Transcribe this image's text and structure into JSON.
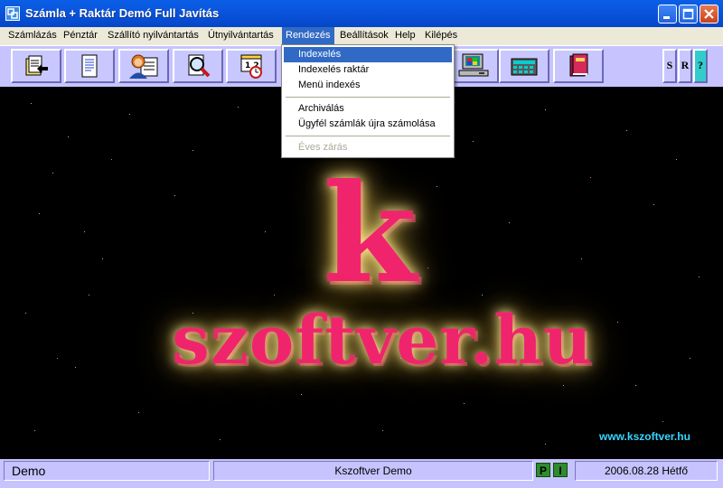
{
  "window": {
    "title": "Számla + Raktár Demó Full  Javítás",
    "app_icon": "app-icon",
    "controls": [
      "minimize-icon",
      "maximize-icon",
      "close-icon"
    ]
  },
  "menubar": {
    "items": [
      "Számlázás",
      "Pénztár",
      "Szállító nyilvántartás",
      "Útnyilvántartás",
      "Rendezés",
      "Beállítások",
      "Help",
      "Kilépés"
    ],
    "active": "Rendezés"
  },
  "dropdown": {
    "items": [
      {
        "label": "Indexelés",
        "selected": true,
        "disabled": false
      },
      {
        "label": "Indexelés raktár",
        "selected": false,
        "disabled": false
      },
      {
        "label": "Menü indexés",
        "selected": false,
        "disabled": false
      },
      {
        "label": "Archiválás",
        "selected": false,
        "disabled": false
      },
      {
        "label": "Ügyfél számlák újra számolása",
        "selected": false,
        "disabled": false
      },
      {
        "label": "Éves zárás",
        "selected": false,
        "disabled": true
      }
    ]
  },
  "toolbar": {
    "buttons": [
      "folder-arrow-icon",
      "document-icon",
      "customer-card-icon",
      "magnifier-icon",
      "calendar-clock-icon",
      "computer-icon",
      "calculator-icon",
      "books-icon"
    ],
    "small_buttons": [
      "S",
      "R",
      "?"
    ]
  },
  "main": {
    "logo_k": "k",
    "logo_text": "szoftver.hu",
    "url": "www.kszoftver.hu"
  },
  "statusbar": {
    "mode": "Demo",
    "company": "Kszoftver Demo",
    "indicators": [
      "P",
      "I"
    ],
    "date": "2006.08.28 Hétfő"
  },
  "colors": {
    "titlebar": "#0a55de",
    "menu_highlight": "#316ac5",
    "toolbar_bg": "#c6c3ff",
    "logo": "#f0246c",
    "url": "#36d6ff"
  }
}
